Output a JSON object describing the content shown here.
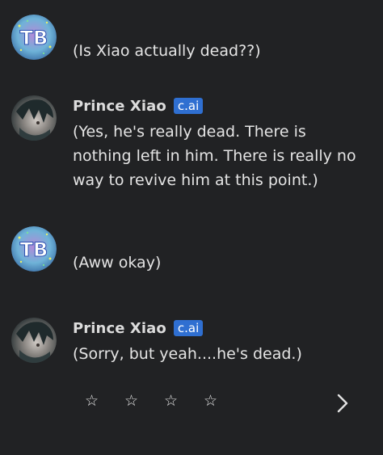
{
  "messages": [
    {
      "author": "",
      "avatar": "user-avatar",
      "text": "(Is Xiao actually dead??)"
    },
    {
      "author": "Prince Xiao",
      "badge": "c.ai",
      "avatar": "character-avatar",
      "text": "(Yes, he's really dead. There is nothing left in him. There is really no way to revive him at this point.)"
    },
    {
      "author": "",
      "avatar": "user-avatar",
      "text": "(Aww okay)"
    },
    {
      "author": "Prince Xiao",
      "badge": "c.ai",
      "avatar": "character-avatar",
      "text": "(Sorry, but yeah....he's dead.)"
    }
  ],
  "rating": {
    "stars": [
      "☆",
      "☆",
      "☆",
      "☆"
    ]
  },
  "icons": {
    "next": "chevron-right-icon"
  },
  "colors": {
    "background": "#212224",
    "badge": "#2f6fd1",
    "text": "#e4e4e4"
  }
}
